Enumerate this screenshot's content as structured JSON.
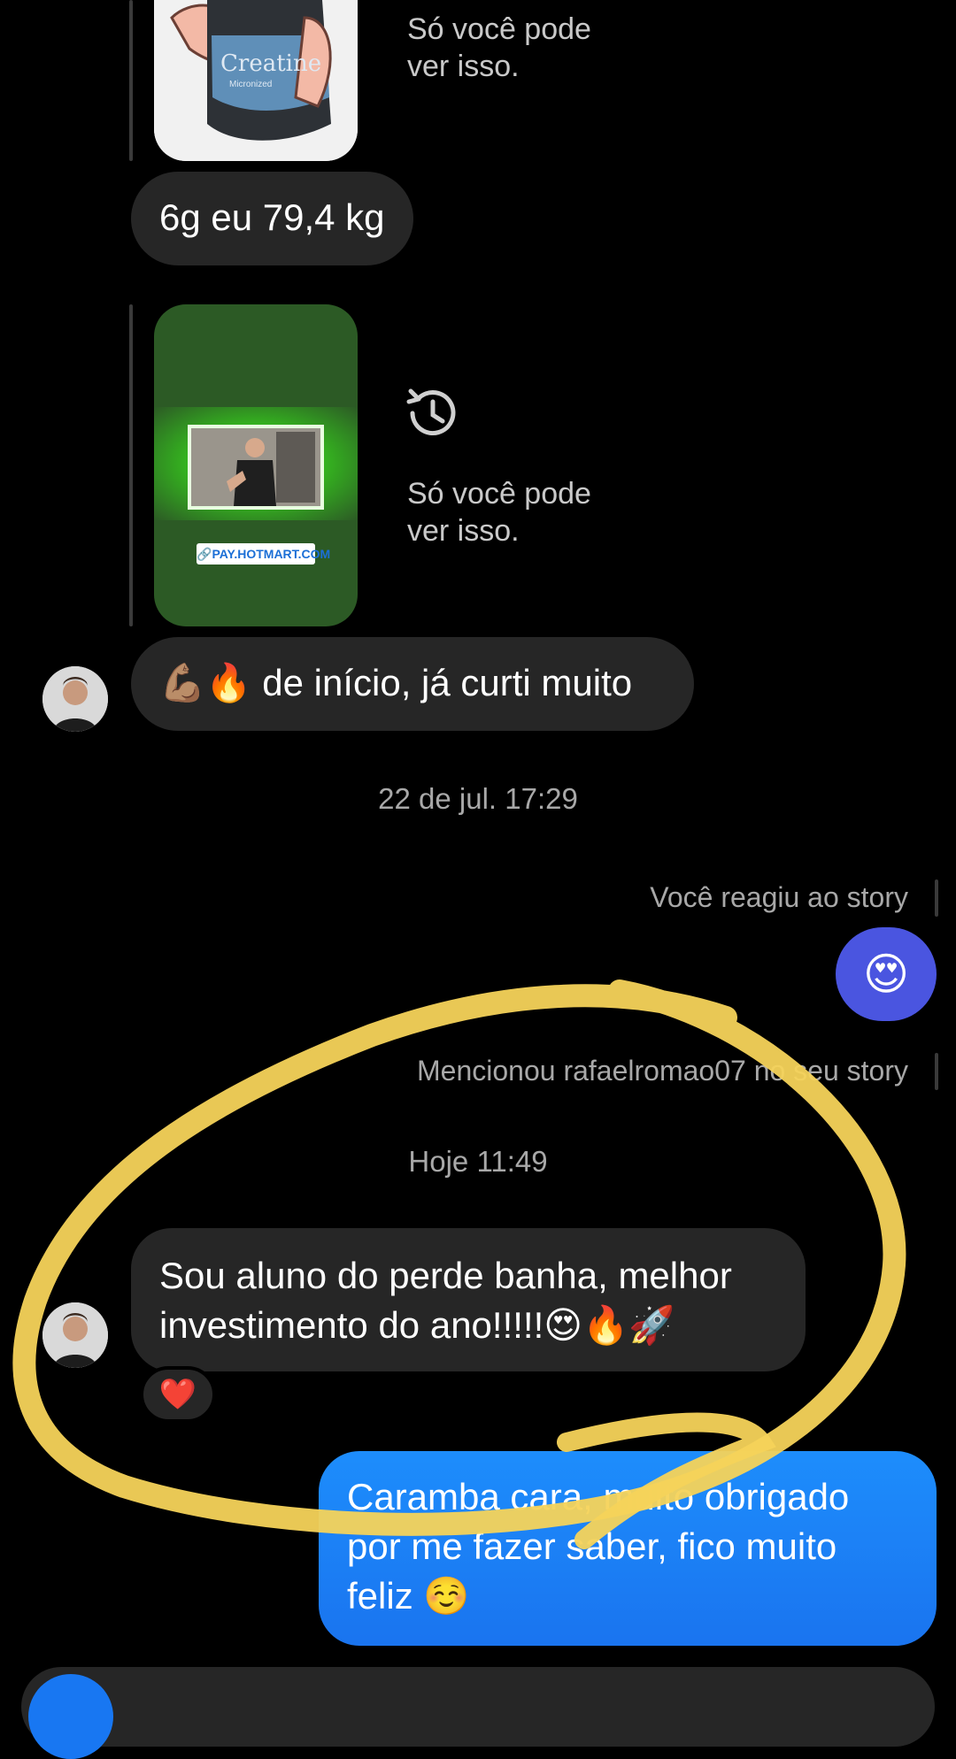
{
  "messages": {
    "story1": {
      "only_you_text": "Só você pode\nver isso.",
      "product_label": "Creatine"
    },
    "msg_creatine": {
      "text": "6g eu 79,4 kg"
    },
    "story2": {
      "only_you_text": "Só você pode\nver isso.",
      "link_label": "PAY.HOTMART.COM",
      "history_icon": "history-icon"
    },
    "msg_inicio": {
      "emoji_prefix": "💪🏽🔥",
      "text": " de início, já curti muito"
    },
    "timestamp1": "22 de jul. 17:29",
    "reacted_story": {
      "text": "Você reagiu ao story",
      "reaction": "😍",
      "bubble_color": "#4a55e0"
    },
    "mention": {
      "text": "Mencionou rafaelromao07 no seu story"
    },
    "timestamp2": "Hoje 11:49",
    "msg_aluno": {
      "text": "Sou aluno do perde banha, melhor investimento do ano!!!!!😍🔥🚀",
      "reaction": "❤️"
    },
    "msg_reply": {
      "text": "Caramba cara,  muito obrigado por me fazer saber,  fico muito feliz ☺️"
    }
  },
  "colors": {
    "accent_blue": "#1877f2",
    "annotation_yellow": "#f5d35a"
  }
}
